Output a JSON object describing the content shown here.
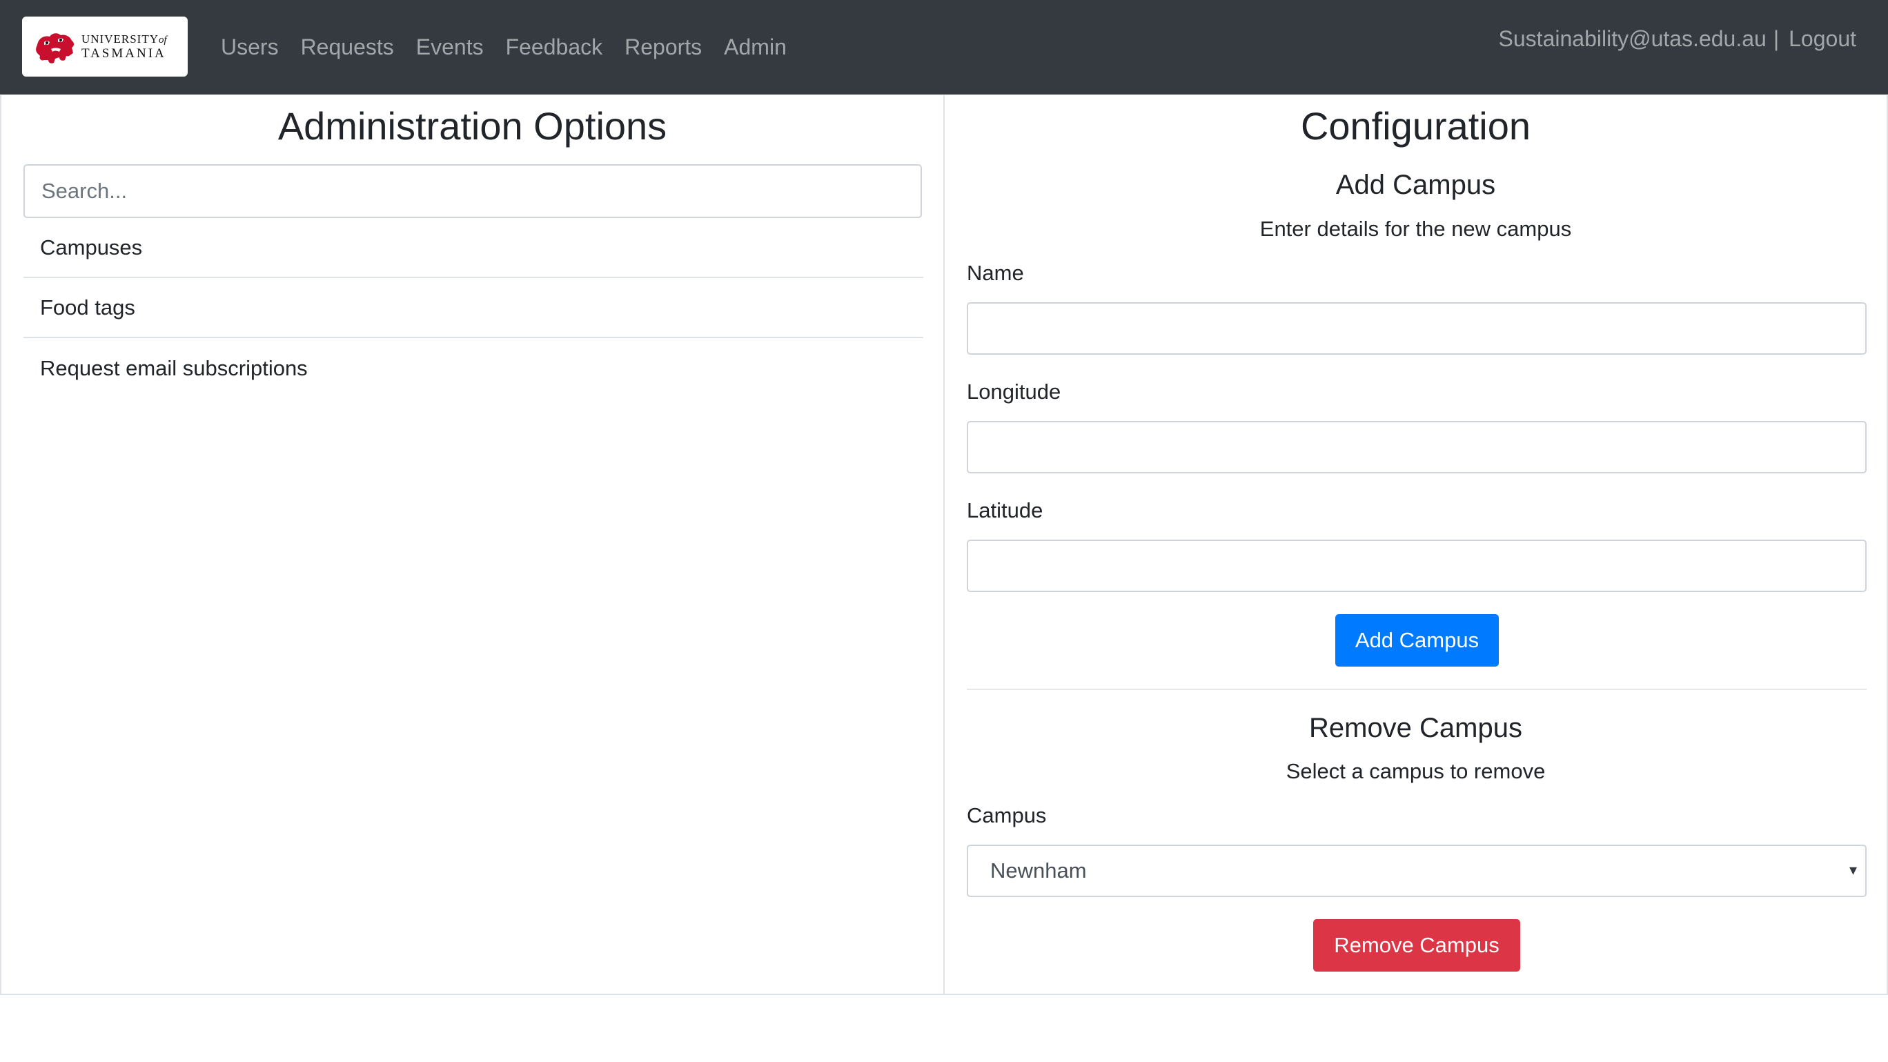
{
  "navbar": {
    "brand": {
      "line1": "UNIVERSITY",
      "of": "of",
      "line2": "TASMANIA"
    },
    "links": [
      "Users",
      "Requests",
      "Events",
      "Feedback",
      "Reports",
      "Admin"
    ],
    "user_email": "Sustainability@utas.edu.au",
    "separator": "|",
    "logout_label": "Logout"
  },
  "admin_options": {
    "title": "Administration Options",
    "search_placeholder": "Search...",
    "items": [
      "Campuses",
      "Food tags",
      "Request email subscriptions"
    ]
  },
  "configuration": {
    "title": "Configuration",
    "add_campus": {
      "title": "Add Campus",
      "subtitle": "Enter details for the new campus",
      "name_label": "Name",
      "name_value": "",
      "longitude_label": "Longitude",
      "longitude_value": "",
      "latitude_label": "Latitude",
      "latitude_value": "",
      "button_label": "Add Campus"
    },
    "remove_campus": {
      "title": "Remove Campus",
      "subtitle": "Select a campus to remove",
      "campus_label": "Campus",
      "selected_campus": "Newnham",
      "button_label": "Remove Campus"
    }
  },
  "colors": {
    "navbar_bg": "#343a40",
    "primary": "#007bff",
    "danger": "#dc3545",
    "crest_red": "#c8102e"
  }
}
